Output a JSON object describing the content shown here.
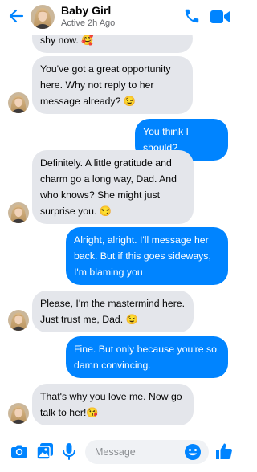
{
  "header": {
    "contact_name": "Baby Girl",
    "status": "Active 2h Ago"
  },
  "messages": [
    {
      "dir": "in",
      "text": "shy now. 🥰"
    },
    {
      "dir": "in",
      "text": "You've got a great opportunity here. Why not reply to her message already? 😉"
    },
    {
      "dir": "out",
      "text": "You think I should?"
    },
    {
      "dir": "in",
      "text": "Definitely. A little gratitude and charm go a long way, Dad. And who knows? She might just surprise you. 😏"
    },
    {
      "dir": "out",
      "text": "Alright, alright. I'll message her back. But if this goes sideways, I'm blaming you"
    },
    {
      "dir": "in",
      "text": "Please, I'm the mastermind here. Just trust me, Dad. 😉"
    },
    {
      "dir": "out",
      "text": "Fine. But only because you're so damn convincing."
    },
    {
      "dir": "in",
      "text": "That's why you love me. Now go talk to her!😘"
    }
  ],
  "composer": {
    "placeholder": "Message"
  },
  "colors": {
    "accent": "#0084ff",
    "incoming_bubble": "#e4e6eb"
  },
  "icons": [
    "back-arrow-icon",
    "phone-icon",
    "video-camera-icon",
    "camera-icon",
    "gallery-icon",
    "microphone-icon",
    "emoji-icon",
    "thumbs-up-icon"
  ]
}
